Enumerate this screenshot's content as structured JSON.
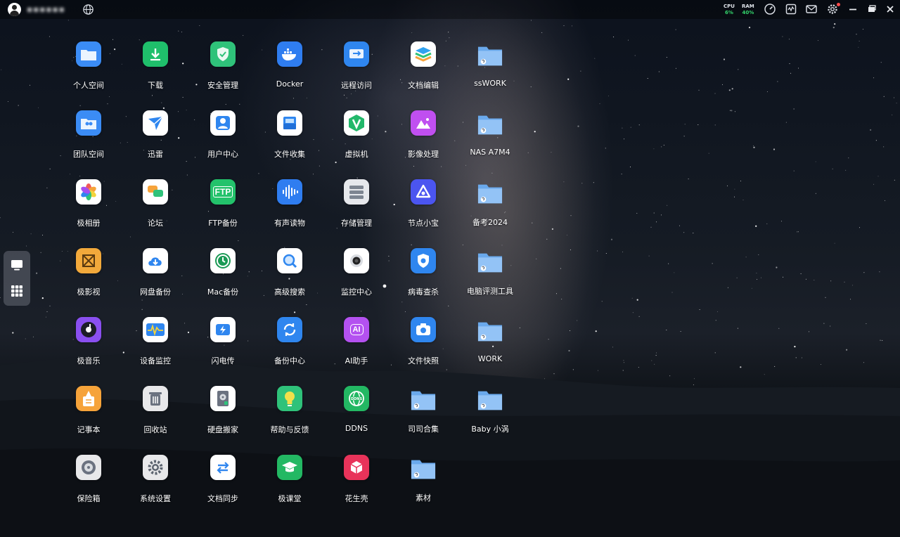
{
  "topbar": {
    "username": "▪▪▪▪▪▪",
    "cpu_label": "CPU",
    "cpu_value": "6%",
    "ram_label": "RAM",
    "ram_value": "40%"
  },
  "apps": [
    {
      "label": "个人空间",
      "icon": "folder-space-icon",
      "color": "#3b8cf5"
    },
    {
      "label": "下载",
      "icon": "download-icon",
      "color": "#1fbf6b"
    },
    {
      "label": "安全管理",
      "icon": "shield-icon",
      "color": "#2fc27a"
    },
    {
      "label": "Docker",
      "icon": "docker-icon",
      "color": "#2f7df0"
    },
    {
      "label": "远程访问",
      "icon": "remote-access-icon",
      "color": "#2f86ef"
    },
    {
      "label": "文档编辑",
      "icon": "layers-icon",
      "color": "#ffffff"
    },
    {
      "label": "团队空间",
      "icon": "team-folder-icon",
      "color": "#3b8cf5"
    },
    {
      "label": "迅雷",
      "icon": "thunder-bird-icon",
      "color": "#ffffff"
    },
    {
      "label": "用户中心",
      "icon": "user-icon",
      "color": "#ffffff"
    },
    {
      "label": "文件收集",
      "icon": "inbox-icon",
      "color": "#ffffff"
    },
    {
      "label": "虚拟机",
      "icon": "vm-v-icon",
      "color": "#ffffff"
    },
    {
      "label": "影像处理",
      "icon": "image-process-icon",
      "color": "#c04ff0"
    },
    {
      "label": "极相册",
      "icon": "photos-flower-icon",
      "color": "#ffffff"
    },
    {
      "label": "论坛",
      "icon": "chat-bubbles-icon",
      "color": "#ffffff"
    },
    {
      "label": "FTP备份",
      "icon": "ftp-icon",
      "color": "#23c26b"
    },
    {
      "label": "有声读物",
      "icon": "audio-wave-icon",
      "color": "#2f7df0"
    },
    {
      "label": "存储管理",
      "icon": "storage-icon",
      "color": "#e6e8ec"
    },
    {
      "label": "节点小宝",
      "icon": "node-icon",
      "color": "#4b55f0"
    },
    {
      "label": "极影视",
      "icon": "video-icon",
      "color": "#f2a93b"
    },
    {
      "label": "网盘备份",
      "icon": "cloud-download-icon",
      "color": "#ffffff"
    },
    {
      "label": "Mac备份",
      "icon": "time-machine-icon",
      "color": "#ffffff"
    },
    {
      "label": "高级搜索",
      "icon": "search-icon",
      "color": "#ffffff"
    },
    {
      "label": "监控中心",
      "icon": "camera-lens-icon",
      "color": "#ffffff"
    },
    {
      "label": "病毒查杀",
      "icon": "antivirus-icon",
      "color": "#2f86ef"
    },
    {
      "label": "极音乐",
      "icon": "music-icon",
      "color": "#8a4ff0"
    },
    {
      "label": "设备监控",
      "icon": "monitor-wave-icon",
      "color": "#ffffff"
    },
    {
      "label": "闪电传",
      "icon": "flash-transfer-icon",
      "color": "#ffffff"
    },
    {
      "label": "备份中心",
      "icon": "sync-icon",
      "color": "#2f86ef"
    },
    {
      "label": "AI助手",
      "icon": "ai-icon",
      "color": "#b451f0"
    },
    {
      "label": "文件快照",
      "icon": "snapshot-camera-icon",
      "color": "#2f86ef"
    },
    {
      "label": "记事本",
      "icon": "notes-icon",
      "color": "#f6a33a"
    },
    {
      "label": "回收站",
      "icon": "trash-icon",
      "color": "#e8e8ea"
    },
    {
      "label": "硬盘搬家",
      "icon": "disk-move-icon",
      "color": "#ffffff"
    },
    {
      "label": "帮助与反馈",
      "icon": "lightbulb-icon",
      "color": "#2fc27a"
    },
    {
      "label": "DDNS",
      "icon": "ddns-globe-icon",
      "color": "#23b863"
    },
    {
      "label": "保险箱",
      "icon": "safe-icon",
      "color": "#e8e8ea"
    },
    {
      "label": "系统设置",
      "icon": "settings-gear-icon",
      "color": "#e8e8ea"
    },
    {
      "label": "文档同步",
      "icon": "doc-sync-icon",
      "color": "#ffffff"
    },
    {
      "label": "极课堂",
      "icon": "graduation-cap-icon",
      "color": "#23b863"
    },
    {
      "label": "花生壳",
      "icon": "peanut-shell-icon",
      "color": "#e8335a"
    }
  ],
  "folders": [
    {
      "label": "ssWORK",
      "icon": "shared-folder-icon"
    },
    {
      "label": "NAS A7M4",
      "icon": "shared-folder-icon"
    },
    {
      "label": "备考2024",
      "icon": "shared-folder-icon"
    },
    {
      "label": "电脑评测工具",
      "icon": "shared-folder-icon"
    },
    {
      "label": "WORK",
      "icon": "shared-folder-icon"
    },
    {
      "label": "司司合集",
      "icon": "shared-folder-icon"
    },
    {
      "label": "Baby 小涡",
      "icon": "shared-folder-icon"
    },
    {
      "label": "素材",
      "icon": "shared-folder-icon"
    }
  ]
}
